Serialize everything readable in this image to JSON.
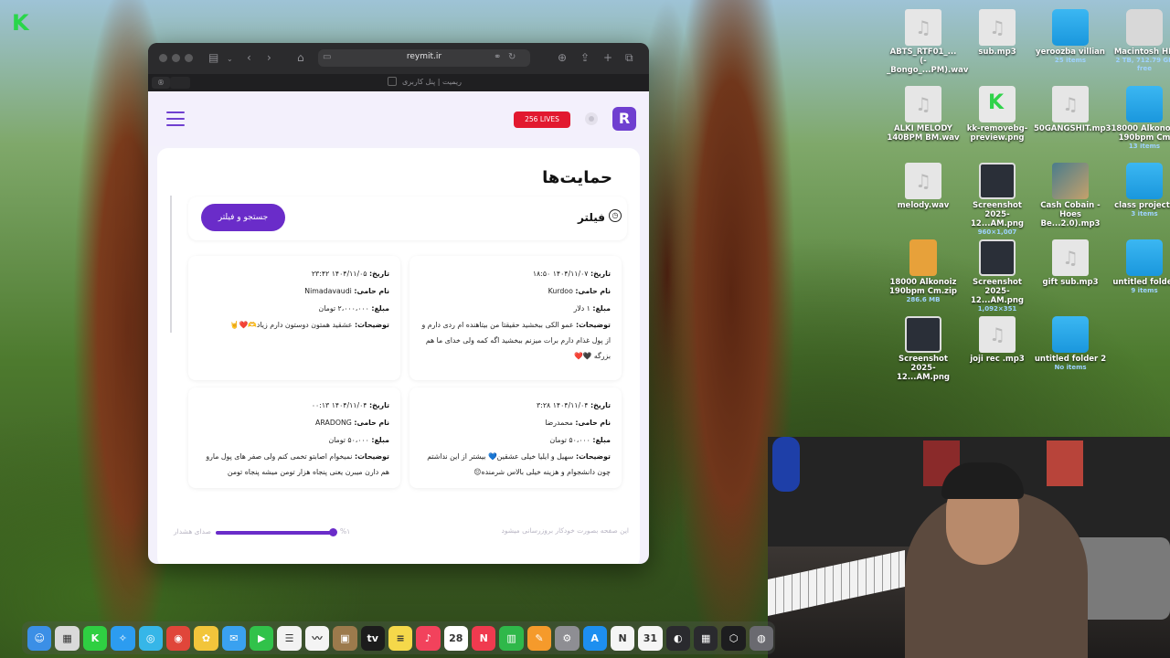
{
  "desktop": {
    "icons": [
      {
        "label": "ABTS_RTF01_...(- _Bongo_...PM).wav",
        "sub": "",
        "type": "file"
      },
      {
        "label": "sub.mp3",
        "sub": "",
        "type": "file"
      },
      {
        "label": "yeroozba villian",
        "sub": "25 items",
        "type": "folder"
      },
      {
        "label": "Macintosh HD",
        "sub": "2 TB, 712.79 GB free",
        "type": "disk"
      },
      {
        "label": "ALKI MELODY 140BPM BM.wav",
        "sub": "",
        "type": "file"
      },
      {
        "label": "kk-removebg-preview.png",
        "sub": "",
        "type": "green"
      },
      {
        "label": "50GANGSHIT.mp3",
        "sub": "",
        "type": "file"
      },
      {
        "label": "18000 Alkonoiz 190bpm Cm",
        "sub": "13 items",
        "type": "folder"
      },
      {
        "label": "melody.wav",
        "sub": "",
        "type": "file"
      },
      {
        "label": "Screenshot 2025-12...AM.png",
        "sub": "960×1,007",
        "type": "shot"
      },
      {
        "label": "Cash Cobain - Hoes Be...2.0).mp3",
        "sub": "",
        "type": "photo"
      },
      {
        "label": "class projects",
        "sub": "3 items",
        "type": "folder"
      },
      {
        "label": "18000 Alkonoiz 190bpm Cm.zip",
        "sub": "286.6 MB",
        "type": "zip"
      },
      {
        "label": "Screenshot 2025-12...AM.png",
        "sub": "1,092×351",
        "type": "shot"
      },
      {
        "label": "gift sub.mp3",
        "sub": "",
        "type": "file"
      },
      {
        "label": "untitled folder",
        "sub": "9 items",
        "type": "folder"
      },
      {
        "label": "Screenshot 2025-12...AM.png",
        "sub": "",
        "type": "shot"
      },
      {
        "label": "joji rec .mp3",
        "sub": "",
        "type": "file"
      },
      {
        "label": "untitled folder 2",
        "sub": "No items",
        "type": "folder"
      }
    ]
  },
  "browser": {
    "url": "reymit.ir",
    "tab_title": "ریمیت | پنل کاربری"
  },
  "header": {
    "logo": "R",
    "lives_badge": "256 LIVES"
  },
  "page": {
    "title": "حمایت‌ها",
    "filter_label": "فیلتر",
    "search_button": "جستجو و فیلتر"
  },
  "labels": {
    "date": "تاریخ:",
    "name": "نام حامی:",
    "amount": "مبلغ:",
    "desc": "توضیحات:"
  },
  "donations": [
    {
      "date": "۱۴۰۴/۱۱/۰۷  ۱۸:۵۰",
      "name": "Kurdoo",
      "amount": "۱ دلار",
      "desc": "عمو الکی ببخشید حقیقتا من بیتاهنده ام ردی دارم و از پول غذام دارم برات میزنم ببخشید اگه کمه ولی خدای ما هم بزرگه 🖤❤️"
    },
    {
      "date": "۱۴۰۴/۱۱/۰۵  ۲۳:۴۲",
      "name": "Nimadavaudi",
      "amount": "۲،۰۰۰،۰۰۰ تومان",
      "desc": "عشقید همتون دوستون دارم زیاد🫶❤️🤘"
    },
    {
      "date": "۱۴۰۴/۱۱/۰۴  ۳:۲۸",
      "name": "محمدرضا",
      "amount": "۵۰،۰۰۰ تومان",
      "desc": "سهیل و ایلیا خیلی عشقین💙 بیشتر از این نداشتم چون دانشجوام و هزینه خیلی بالاس شرمنده😔"
    },
    {
      "date": "۱۴۰۴/۱۱/۰۴  ۰۰:۱۳",
      "name": "ARADONG",
      "amount": "۵۰،۰۰۰ تومان",
      "desc": "نمیخوام اصابتو تخمی کنم ولی صفر های پول مارو هم دارن میبرن یعنی پنجاه هزار تومن میشه پنجاه تومن"
    }
  ],
  "footer": {
    "auto_refresh": "این صفحه بصورت خودکار بروزرسانی میشود",
    "volume_label": "صدای هشدار",
    "volume_pct": "%۱"
  },
  "dock": {
    "apps": [
      {
        "name": "Finder",
        "color": "#3b8fe6",
        "glyph": "☺"
      },
      {
        "name": "Launchpad",
        "color": "#d9d9d9",
        "glyph": "▦"
      },
      {
        "name": "Kick",
        "color": "#2fcf42",
        "glyph": "K"
      },
      {
        "name": "Safari",
        "color": "#2c9cf0",
        "glyph": "✧"
      },
      {
        "name": "Helper",
        "color": "#36b6e8",
        "glyph": "◎"
      },
      {
        "name": "Chrome",
        "color": "#e0463a",
        "glyph": "◉"
      },
      {
        "name": "Photos",
        "color": "#f2c53b",
        "glyph": "✿"
      },
      {
        "name": "Mail",
        "color": "#3aa1f0",
        "glyph": "✉"
      },
      {
        "name": "FaceTime",
        "color": "#31c24a",
        "glyph": "▶"
      },
      {
        "name": "Reminders",
        "color": "#f2f2f2",
        "glyph": "☰"
      },
      {
        "name": "Freeform",
        "color": "#f4f4f4",
        "glyph": "〰"
      },
      {
        "name": "Notes-brown",
        "color": "#9c7a4c",
        "glyph": "▣"
      },
      {
        "name": "TV",
        "color": "#1c1c1c",
        "glyph": "tv"
      },
      {
        "name": "Notes",
        "color": "#f5d84a",
        "glyph": "≡"
      },
      {
        "name": "Music",
        "color": "#f2425c",
        "glyph": "♪"
      },
      {
        "name": "Calendar",
        "color": "#ffffff",
        "glyph": "28"
      },
      {
        "name": "News",
        "color": "#f03a4f",
        "glyph": "N"
      },
      {
        "name": "Numbers",
        "color": "#2fb84a",
        "glyph": "▥"
      },
      {
        "name": "Pages",
        "color": "#f59a2b",
        "glyph": "✎"
      },
      {
        "name": "Settings",
        "color": "#8e8e93",
        "glyph": "⚙"
      },
      {
        "name": "App Store",
        "color": "#1d8ff0",
        "glyph": "A"
      },
      {
        "name": "Notion",
        "color": "#f5f5f5",
        "glyph": "N"
      },
      {
        "name": "Fantastical",
        "color": "#f5f5f5",
        "glyph": "31"
      },
      {
        "name": "Activity",
        "color": "#2a2a2e",
        "glyph": "◐"
      },
      {
        "name": "Grid",
        "color": "#2a2a2e",
        "glyph": "▦"
      },
      {
        "name": "Unity",
        "color": "#1d1d1f",
        "glyph": "⬡"
      },
      {
        "name": "Disk",
        "color": "#6a6a70",
        "glyph": "◍"
      }
    ]
  }
}
